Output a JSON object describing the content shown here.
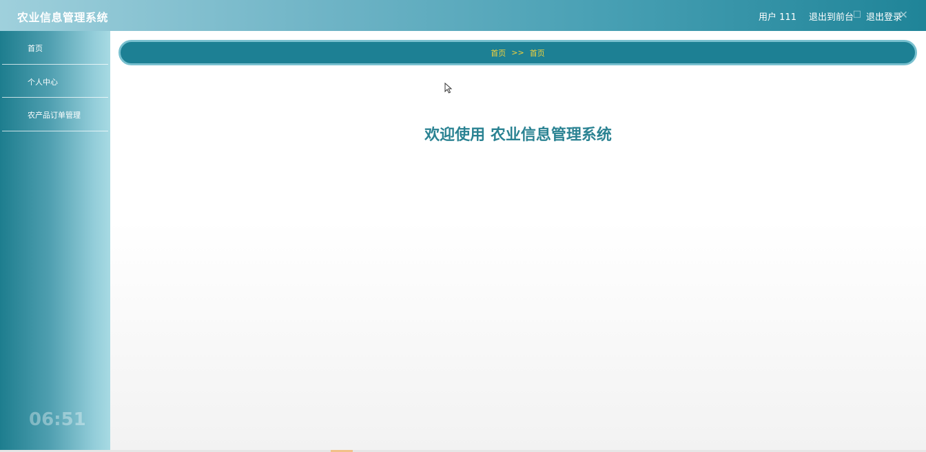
{
  "header": {
    "app_title": "农业信息管理系统",
    "user_label": "用户 111",
    "back_to_front": "退出到前台",
    "logout": "退出登录"
  },
  "sidebar": {
    "items": [
      {
        "label": "首页"
      },
      {
        "label": "个人中心"
      },
      {
        "label": "农产品订单管理"
      }
    ],
    "clock": "06:51"
  },
  "main": {
    "breadcrumb": {
      "first": "首页",
      "separator": ">>",
      "second": "首页"
    },
    "welcome": "欢迎使用 农业信息管理系统"
  },
  "colors": {
    "header_gradient": [
      "#9fd0dc",
      "#1f8498"
    ],
    "breadcrumb_bg": "#1d8094",
    "breadcrumb_text": "#f5d33a",
    "welcome_text": "#2a8292"
  },
  "icons": {
    "window_minimize": "minimize-icon",
    "window_maximize": "maximize-icon",
    "window_close": "close-icon",
    "cursor": "mouse-pointer-icon"
  }
}
